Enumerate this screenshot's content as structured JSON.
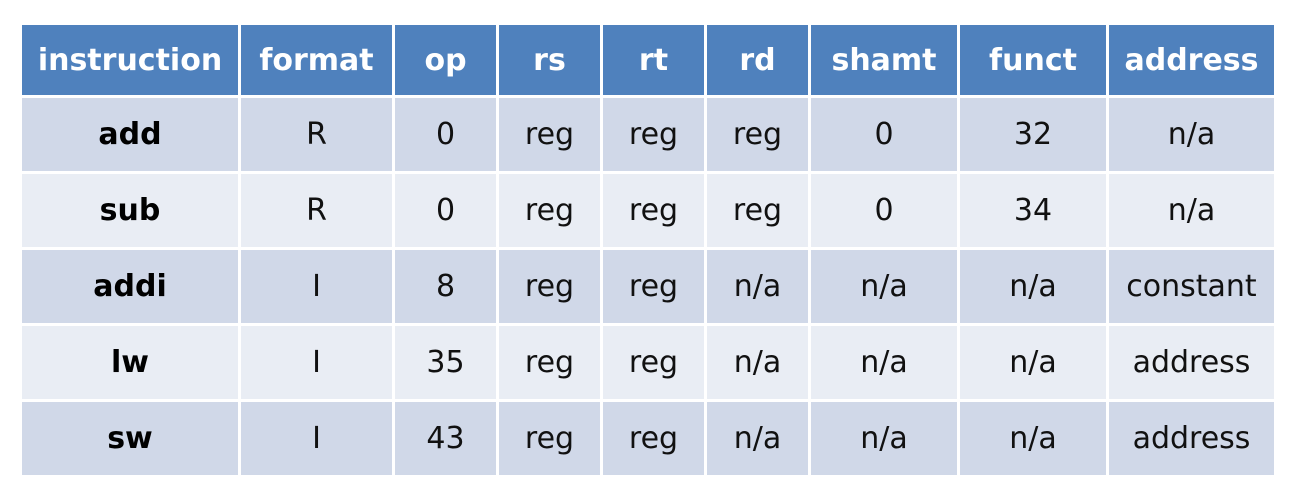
{
  "table": {
    "headers": [
      "instruction",
      "format",
      "op",
      "rs",
      "rt",
      "rd",
      "shamt",
      "funct",
      "address"
    ],
    "rows": [
      [
        "add",
        "R",
        "0",
        "reg",
        "reg",
        "reg",
        "0",
        "32",
        "n/a"
      ],
      [
        "sub",
        "R",
        "0",
        "reg",
        "reg",
        "reg",
        "0",
        "34",
        "n/a"
      ],
      [
        "addi",
        "I",
        "8",
        "reg",
        "reg",
        "n/a",
        "n/a",
        "n/a",
        "constant"
      ],
      [
        "lw",
        "I",
        "35",
        "reg",
        "reg",
        "n/a",
        "n/a",
        "n/a",
        "address"
      ],
      [
        "sw",
        "I",
        "43",
        "reg",
        "reg",
        "n/a",
        "n/a",
        "n/a",
        "address"
      ]
    ]
  },
  "colors": {
    "header_bg": "#4f81bd",
    "header_text": "#ffffff",
    "row_odd_bg": "#d0d8e8",
    "row_even_bg": "#e9edf4"
  }
}
